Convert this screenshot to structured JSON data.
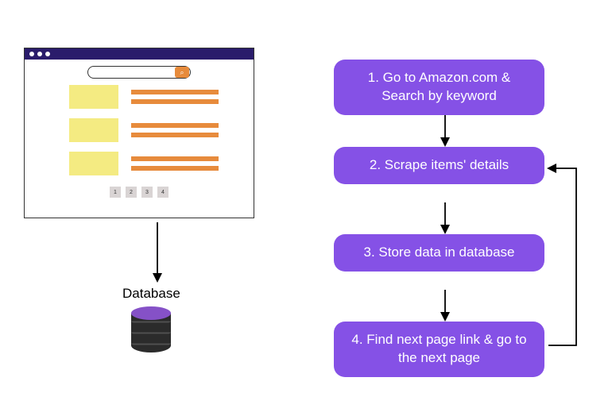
{
  "browser": {
    "pager": [
      "1",
      "2",
      "3",
      "4"
    ]
  },
  "database_label": "Database",
  "steps": {
    "s1": "1. Go to Amazon.com & Search by keyword",
    "s2": "2. Scrape items' details",
    "s3": "3. Store data in database",
    "s4": "4. Find next page link & go to the next page"
  }
}
